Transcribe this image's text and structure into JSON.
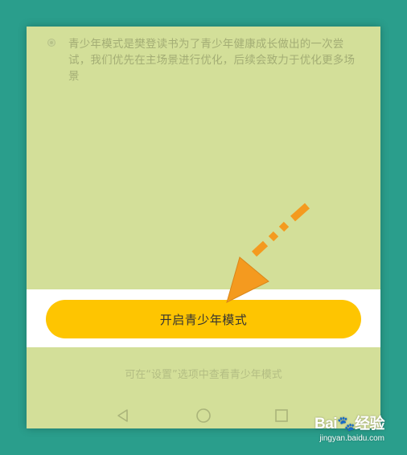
{
  "notice": {
    "text": "青少年模式是樊登读书为了青少年健康成长做出的一次尝试，我们优先在主场景进行优化，后续会致力于优化更多场景"
  },
  "primary_button": {
    "label": "开启青少年模式"
  },
  "hint": {
    "text": "可在“设置”选项中查看青少年模式"
  },
  "navbar": {
    "back_icon": "triangle-back-icon",
    "home_icon": "circle-home-icon",
    "recents_icon": "square-recents-icon"
  },
  "watermark": {
    "brand": "Bai",
    "brand_suffix": "经验",
    "url": "jingyan.baidu.com"
  },
  "colors": {
    "frame_bg": "#2a9e8c",
    "screen_bg": "#d3df99",
    "button": "#fec501",
    "arrow": "#f49a1f"
  }
}
